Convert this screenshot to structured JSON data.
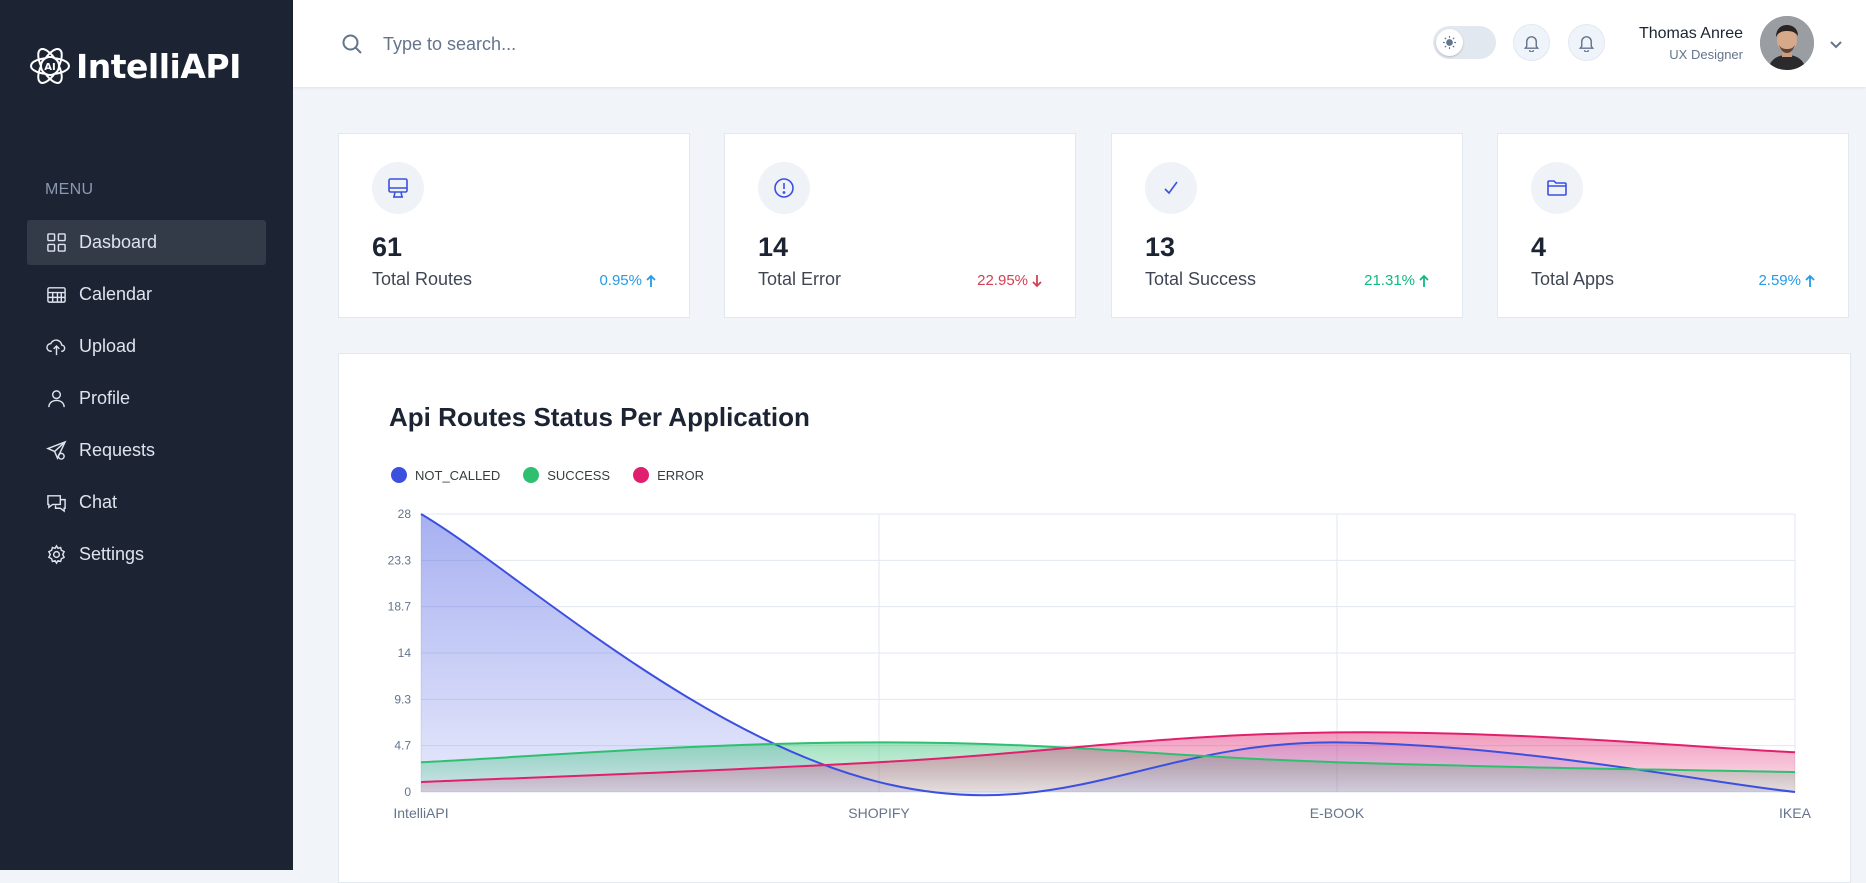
{
  "app": {
    "logo_text": "IntelliAPI"
  },
  "sidebar": {
    "menu_heading": "MENU",
    "items": [
      {
        "label": "Dasboard",
        "icon": "grid-icon",
        "active": true
      },
      {
        "label": "Calendar",
        "icon": "calendar-icon",
        "active": false
      },
      {
        "label": "Upload",
        "icon": "cloud-upload-icon",
        "active": false
      },
      {
        "label": "Profile",
        "icon": "user-icon",
        "active": false
      },
      {
        "label": "Requests",
        "icon": "send-icon",
        "active": false
      },
      {
        "label": "Chat",
        "icon": "chat-icon",
        "active": false
      },
      {
        "label": "Settings",
        "icon": "gear-icon",
        "active": false
      }
    ]
  },
  "header": {
    "search_placeholder": "Type to search...",
    "user_name": "Thomas Anree",
    "user_role": "UX Designer"
  },
  "stats": [
    {
      "value": "61",
      "label": "Total Routes",
      "trend": "0.95%",
      "direction": "up",
      "trend_color": "#259ae6",
      "icon": "monitor-icon"
    },
    {
      "value": "14",
      "label": "Total Error",
      "trend": "22.95%",
      "direction": "down",
      "trend_color": "#d34053",
      "icon": "alert-circle-icon"
    },
    {
      "value": "13",
      "label": "Total Success",
      "trend": "21.31%",
      "direction": "up",
      "trend_color": "#10b981",
      "icon": "check-icon"
    },
    {
      "value": "4",
      "label": "Total Apps",
      "trend": "2.59%",
      "direction": "up",
      "trend_color": "#259ae6",
      "icon": "folder-icon"
    }
  ],
  "chart_data": {
    "type": "area",
    "title": "Api Routes Status Per Application",
    "categories": [
      "IntelliAPI",
      "SHOPIFY",
      "E-BOOK",
      "IKEA"
    ],
    "series": [
      {
        "name": "NOT_CALLED",
        "color": "#3c50e0",
        "values": [
          28,
          1,
          5,
          0
        ]
      },
      {
        "name": "SUCCESS",
        "color": "#2fbf71",
        "values": [
          3,
          5,
          3,
          2
        ]
      },
      {
        "name": "ERROR",
        "color": "#e0206e",
        "values": [
          1,
          3,
          6,
          4
        ]
      }
    ],
    "y_ticks": [
      "0",
      "4.7",
      "9.3",
      "14",
      "18.7",
      "23.3",
      "28"
    ],
    "ylim": [
      0,
      28
    ],
    "legend_position": "top-left",
    "grid": true
  }
}
